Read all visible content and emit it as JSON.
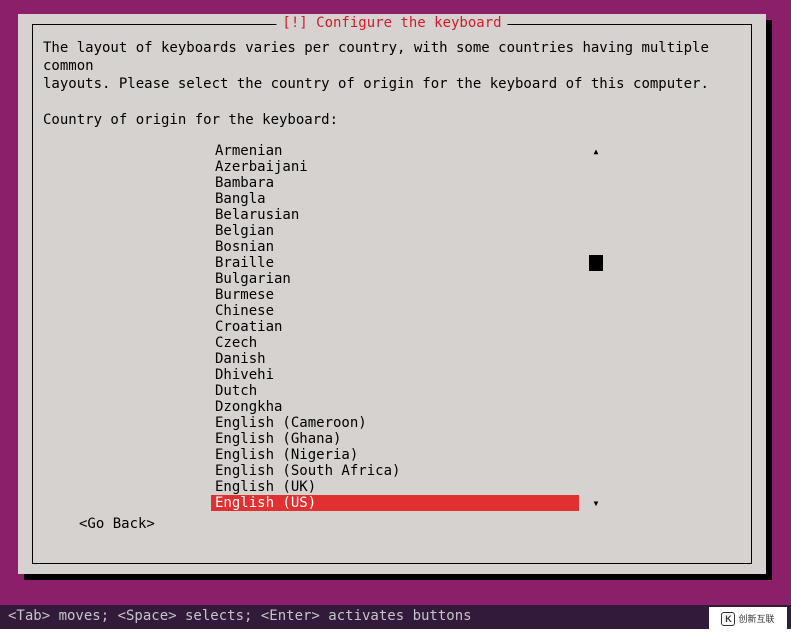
{
  "dialog": {
    "title": "[!] Configure the keyboard",
    "description_line1": "The layout of keyboards varies per country, with some countries having multiple common",
    "description_line2": "layouts. Please select the country of origin for the keyboard of this computer.",
    "prompt": "Country of origin for the keyboard:",
    "go_back": "<Go Back>"
  },
  "list": {
    "items": [
      "Armenian",
      "Azerbaijani",
      "Bambara",
      "Bangla",
      "Belarusian",
      "Belgian",
      "Bosnian",
      "Braille",
      "Bulgarian",
      "Burmese",
      "Chinese",
      "Croatian",
      "Czech",
      "Danish",
      "Dhivehi",
      "Dutch",
      "Dzongkha",
      "English (Cameroon)",
      "English (Ghana)",
      "English (Nigeria)",
      "English (South Africa)",
      "English (UK)",
      "English (US)"
    ],
    "selected_index": 22,
    "scroll_thumb_row": 7
  },
  "hint": "<Tab> moves; <Space> selects; <Enter> activates buttons",
  "watermark": {
    "logo": "K",
    "text": "创新互联"
  }
}
